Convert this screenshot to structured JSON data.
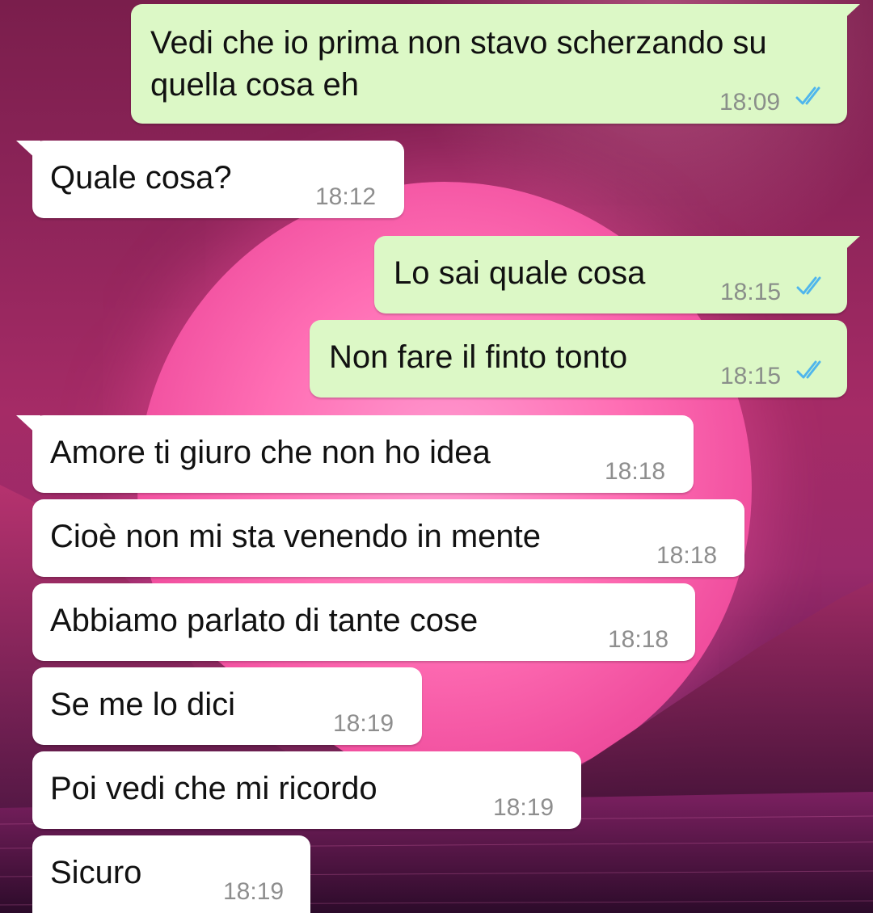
{
  "colors": {
    "outgoing_bubble": "#dcf8c6",
    "incoming_bubble": "#ffffff",
    "read_ticks": "#4fb6ec",
    "timestamp": "#8a8f8a"
  },
  "messages": [
    {
      "direction": "outgoing",
      "lines": [
        "Vedi che io prima non stavo scherzando su",
        "quella cosa eh"
      ],
      "time": "18:09",
      "status": "read"
    },
    {
      "direction": "incoming",
      "text": "Quale cosa?",
      "time": "18:12"
    },
    {
      "direction": "outgoing",
      "text": "Lo sai quale cosa",
      "time": "18:15",
      "status": "read"
    },
    {
      "direction": "outgoing",
      "text": "Non fare il finto tonto",
      "time": "18:15",
      "status": "read"
    },
    {
      "direction": "incoming",
      "text": "Amore ti giuro che non ho idea",
      "time": "18:18"
    },
    {
      "direction": "incoming",
      "text": "Cioè non mi sta venendo in mente",
      "time": "18:18"
    },
    {
      "direction": "incoming",
      "text": "Abbiamo parlato di tante cose",
      "time": "18:18"
    },
    {
      "direction": "incoming",
      "text": "Se me lo dici",
      "time": "18:19"
    },
    {
      "direction": "incoming",
      "text": "Poi vedi che mi ricordo",
      "time": "18:19"
    },
    {
      "direction": "incoming",
      "text": "Sicuro",
      "time": "18:19"
    }
  ]
}
